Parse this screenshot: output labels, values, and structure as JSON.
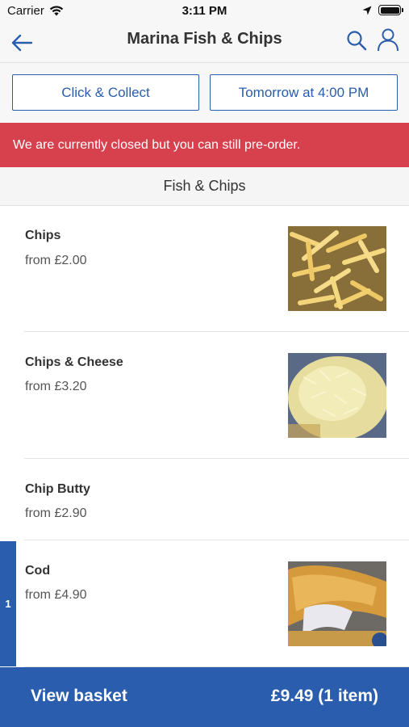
{
  "status_bar": {
    "carrier": "Carrier",
    "time": "3:11 PM",
    "icons": [
      "wifi-icon",
      "location-arrow-icon",
      "battery-icon"
    ]
  },
  "header": {
    "title": "Marina Fish & Chips",
    "icons": [
      "back-arrow-icon",
      "search-icon",
      "account-icon"
    ],
    "accent_color": "#2a5dad"
  },
  "order_options": {
    "collection_label": "Click & Collect",
    "time_label": "Tomorrow at 4:00 PM"
  },
  "banner": {
    "message": "We are currently closed but you can still pre-order.",
    "color": "#d6414d"
  },
  "category": {
    "title": "Fish & Chips"
  },
  "menu_items": [
    {
      "name": "Chips",
      "price": "from £2.00",
      "has_image": true
    },
    {
      "name": "Chips & Cheese",
      "price": "from £3.20",
      "has_image": true
    },
    {
      "name": "Chip Butty",
      "price": "from £2.90",
      "has_image": false
    },
    {
      "name": "Cod",
      "price": "from £4.90",
      "has_image": true,
      "quantity_in_basket": "1"
    }
  ],
  "basket": {
    "label": "View basket",
    "total": "£9.49 (1 item)",
    "color": "#2a5dad"
  }
}
